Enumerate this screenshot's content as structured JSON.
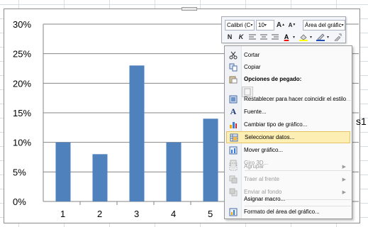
{
  "chart_data": {
    "type": "bar",
    "categories": [
      "1",
      "2",
      "3",
      "4",
      "5"
    ],
    "values": [
      0.1,
      0.08,
      0.23,
      0.1,
      0.14
    ],
    "y_ticks": [
      "0%",
      "5%",
      "10%",
      "15%",
      "20%",
      "25%",
      "30%"
    ],
    "ylim": [
      0,
      0.3
    ],
    "bar_color": "#4f81bd",
    "gridlines": true,
    "legend_fragment": "s1"
  },
  "mini_toolbar": {
    "font": "Calibri (C",
    "size": "10",
    "grow": "A",
    "shrink": "A",
    "chart_element": "Área del gráfic",
    "bold": "N",
    "italic": "K"
  },
  "context_menu": {
    "items": [
      {
        "label": "Cortar",
        "icon": "scissors-icon"
      },
      {
        "label": "Copiar",
        "icon": "copy-icon"
      },
      {
        "label": "Opciones de pegado:",
        "icon": "paste-icon"
      },
      {
        "label": "Restablecer para hacer coincidir el estilo",
        "icon": "reset-style-icon"
      },
      {
        "label": "Fuente...",
        "icon": "font-icon"
      },
      {
        "label": "Cambiar tipo de gráfico...",
        "icon": "chart-type-icon"
      },
      {
        "label": "Seleccionar datos...",
        "icon": "select-data-icon"
      },
      {
        "label": "Mover gráfico...",
        "icon": "move-chart-icon"
      },
      {
        "label": "Giro 3D...",
        "icon": "rotate-3d-icon"
      },
      {
        "label": "Agrupar",
        "icon": "group-icon"
      },
      {
        "label": "Traer al frente",
        "icon": "bring-front-icon"
      },
      {
        "label": "Enviar al fondo",
        "icon": "send-back-icon"
      },
      {
        "label": "Asignar macro...",
        "icon": ""
      },
      {
        "label": "Formato del área del gráfico...",
        "icon": "format-area-icon"
      }
    ]
  },
  "colors": {
    "accent_blue": "#4f81bd",
    "menu_highlight": "#fdeeb3"
  }
}
